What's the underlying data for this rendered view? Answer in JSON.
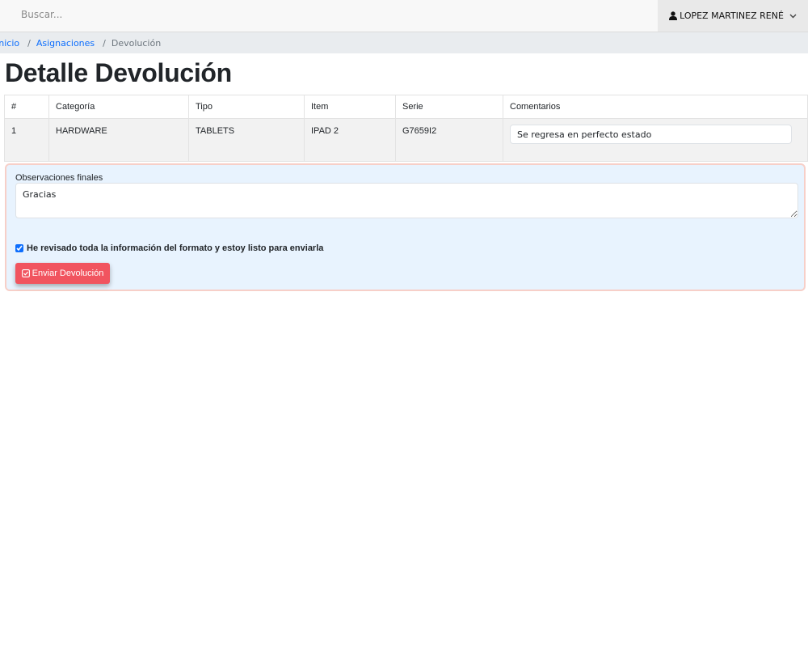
{
  "search": {
    "placeholder": "Buscar..."
  },
  "user": {
    "name": "LOPEZ MARTINEZ RENÉ"
  },
  "breadcrumb": {
    "items": [
      "Inicio",
      "Asignaciones"
    ],
    "current": "Devolución"
  },
  "page": {
    "title": "Detalle Devolución"
  },
  "table": {
    "headers": [
      "#",
      "Categoría",
      "Tipo",
      "Item",
      "Serie",
      "Comentarios"
    ],
    "rows": [
      {
        "num": "1",
        "categoria": "HARDWARE",
        "tipo": "TABLETS",
        "item": "IPAD 2",
        "serie": "G7659I2",
        "comentario": "Se regresa en perfecto estado"
      }
    ]
  },
  "form": {
    "observaciones_label": "Observaciones finales",
    "observaciones_value": "Gracias",
    "confirm_label": "He revisado toda la información del formato y estoy listo para enviarla",
    "confirm_checked": true,
    "submit_label": "Enviar Devolución"
  },
  "colors": {
    "link": "#0d6efd",
    "submit_button": "#f1545f",
    "panel_background": "#e8f3fe",
    "panel_border": "#f7cfc8"
  },
  "icons": {
    "user": "user-icon",
    "dropdown": "chevron-down-icon",
    "submit": "check-square-icon"
  }
}
